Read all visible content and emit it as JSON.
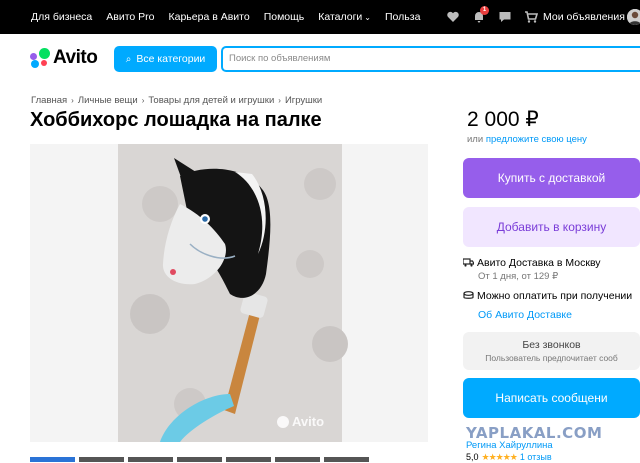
{
  "topbar": {
    "nav": [
      "Для бизнеса",
      "Авито Pro",
      "Карьера в Авито",
      "Помощь",
      "Каталоги",
      "Польза"
    ],
    "notifications_count": "1",
    "my_ads": "Мои объявления"
  },
  "header": {
    "logo": "Avito",
    "categories_button": "Все категории",
    "search_placeholder": "Поиск по объявлениям",
    "brand_colors": {
      "blue": "#00aaff",
      "purple": "#965eeb",
      "green": "#04e061",
      "red": "#ff4053"
    }
  },
  "breadcrumb": [
    "Главная",
    "Личные вещи",
    "Товары для детей и игрушки",
    "Игрушки"
  ],
  "listing": {
    "title": "Хоббихорс лошадка на палке",
    "price": "2 000 ₽",
    "price_hint_prefix": "или",
    "price_hint_link": "предложите свою цену",
    "photo_watermark": "Avito"
  },
  "actions": {
    "buy_with_delivery": "Купить с доставкой",
    "add_to_cart": "Добавить в корзину",
    "no_calls_title": "Без звонков",
    "no_calls_subtitle": "Пользователь предпочитает сооб",
    "write_message": "Написать сообщени"
  },
  "delivery": {
    "title": "Авито Доставка в Москву",
    "details": "От 1 дня, от 129 ₽",
    "pay_on_receipt": "Можно оплатить при получении",
    "about_link": "Об Авито Доставке"
  },
  "seller": {
    "name": "Регина Хайруллина",
    "rating": "5,0",
    "stars": "★★★★★",
    "reviews": "1 отзыв"
  },
  "site_watermark": "YAPLAKAL.COM"
}
